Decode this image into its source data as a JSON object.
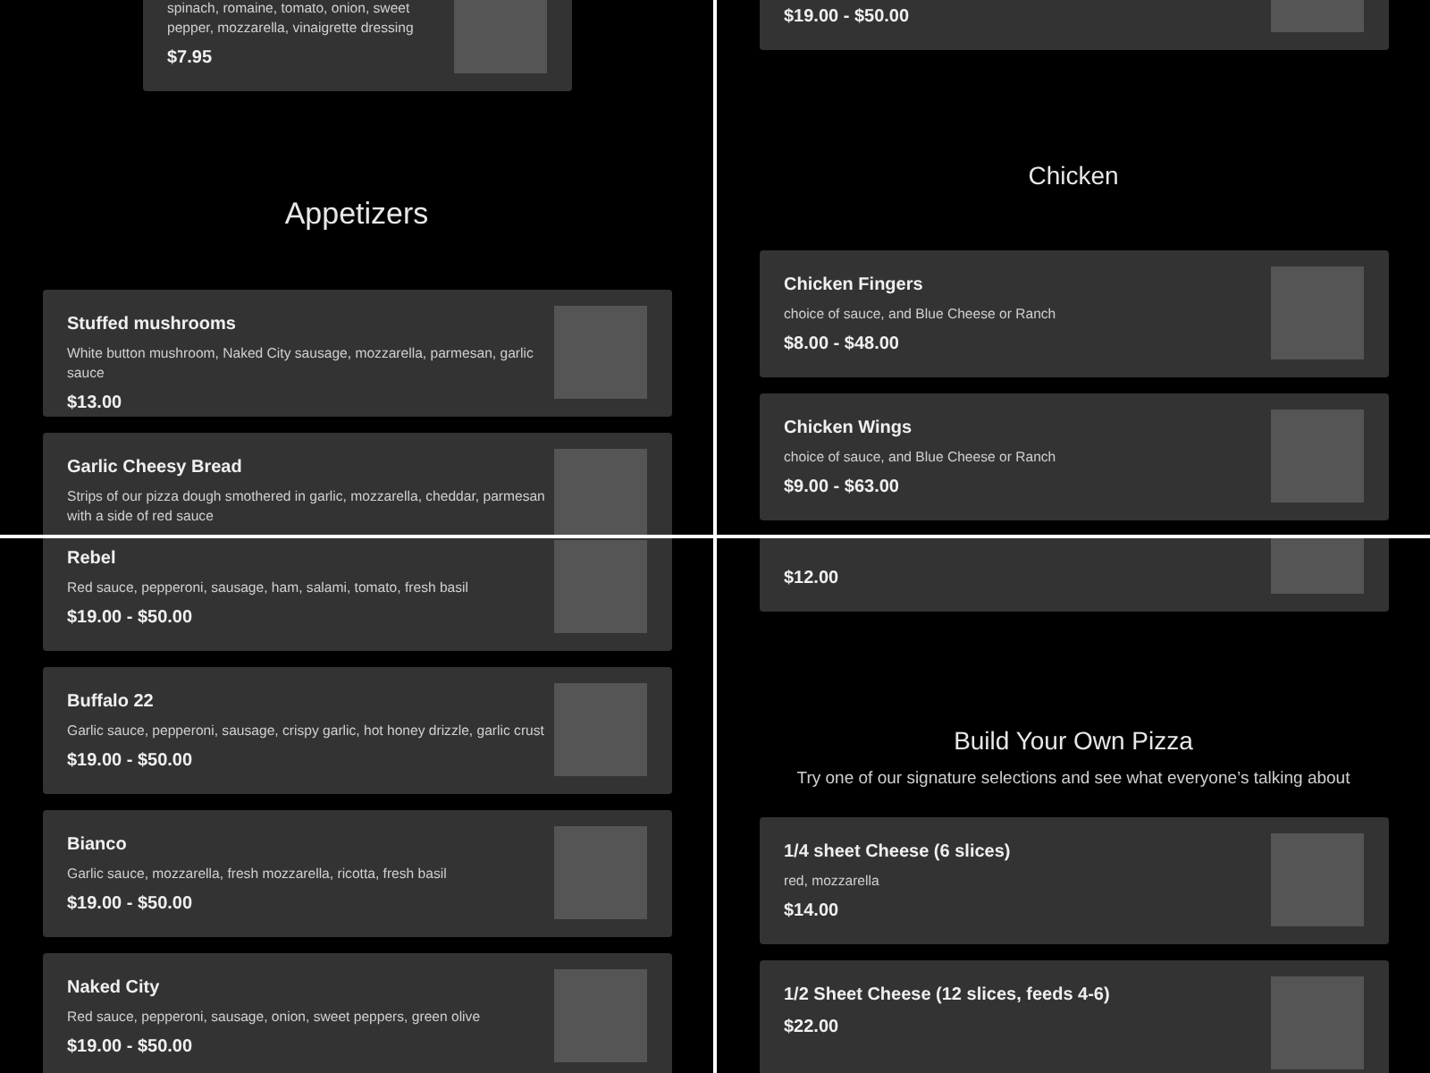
{
  "panels": [
    {
      "blocks": [
        {
          "kind": "card",
          "description": "spinach, romaine, tomato, onion, sweet pepper, mozzarella, vinaigrette dressing",
          "price": "$7.95"
        },
        {
          "kind": "heading",
          "title": "Appetizers"
        },
        {
          "kind": "card",
          "title": "Stuffed mushrooms",
          "description": "White button mushroom, Naked City sausage, mozzarella, parmesan, garlic sauce",
          "price": "$13.00"
        },
        {
          "kind": "card",
          "title": "Garlic Cheesy Bread",
          "description": "Strips of our pizza dough smothered in garlic, mozzarella, cheddar, parmesan with a side of red sauce"
        }
      ]
    },
    {
      "blocks": [
        {
          "kind": "card",
          "price": "$19.00 - $50.00"
        },
        {
          "kind": "heading",
          "title": "Chicken"
        },
        {
          "kind": "card",
          "title": "Chicken Fingers",
          "description": "choice of sauce, and Blue Cheese or Ranch",
          "price": "$8.00 - $48.00"
        },
        {
          "kind": "card",
          "title": "Chicken Wings",
          "description": "choice of sauce, and Blue Cheese or Ranch",
          "price": "$9.00 - $63.00"
        }
      ]
    },
    {
      "blocks": [
        {
          "kind": "card",
          "title": "Rebel",
          "description": "Red sauce, pepperoni, sausage, ham, salami, tomato, fresh basil",
          "price": "$19.00 - $50.00"
        },
        {
          "kind": "card",
          "title": "Buffalo 22",
          "description": "Garlic sauce, pepperoni, sausage, crispy garlic, hot honey drizzle, garlic crust",
          "price": "$19.00 - $50.00"
        },
        {
          "kind": "card",
          "title": "Bianco",
          "description": "Garlic sauce, mozzarella, fresh mozzarella, ricotta, fresh basil",
          "price": "$19.00 - $50.00"
        },
        {
          "kind": "card",
          "title": "Naked City",
          "description": "Red sauce, pepperoni, sausage, onion, sweet peppers, green olive",
          "price": "$19.00 - $50.00"
        }
      ]
    },
    {
      "blocks": [
        {
          "kind": "card",
          "price": "$12.00"
        },
        {
          "kind": "heading",
          "title": "Build Your Own Pizza",
          "subtitle": "Try one of our signature selections and see what everyone’s talking about"
        },
        {
          "kind": "card",
          "title": "1/4 sheet Cheese (6 slices)",
          "description": "red, mozzarella",
          "price": "$14.00"
        },
        {
          "kind": "card",
          "title": "1/2 Sheet Cheese (12 slices, feeds 4-6)",
          "price": "$22.00"
        }
      ]
    }
  ]
}
